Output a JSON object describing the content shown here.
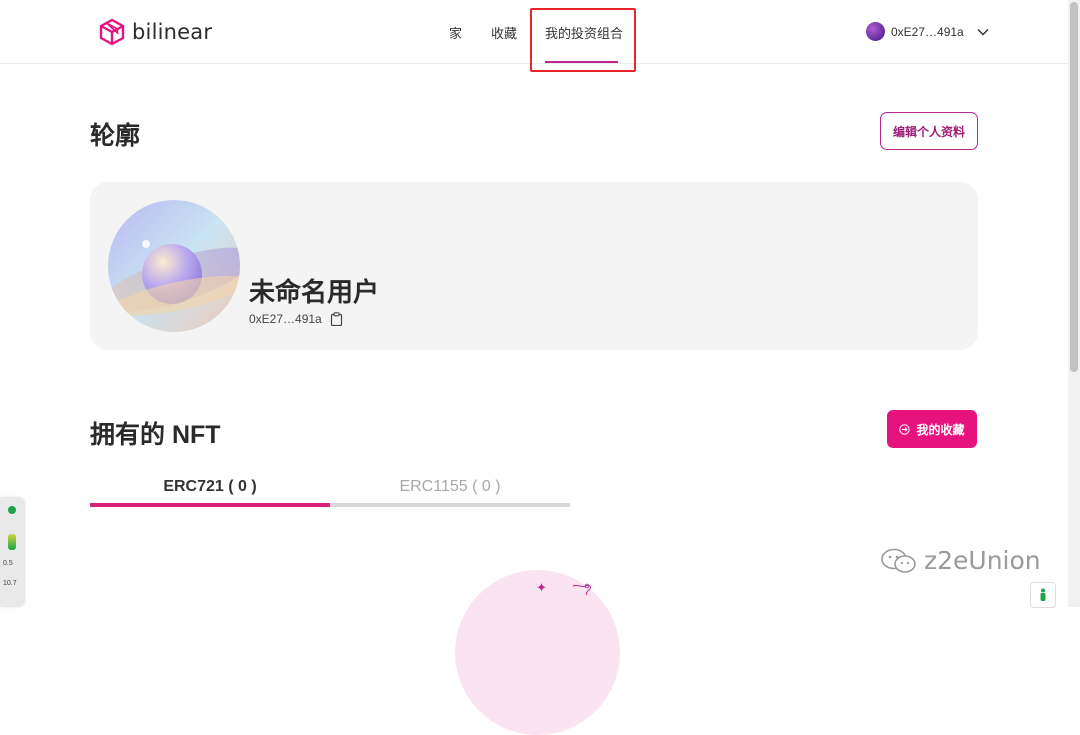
{
  "app": {
    "brand_name": "bilinear",
    "brand_color": "#e6137f"
  },
  "nav": {
    "home": "家",
    "favorites": "收藏",
    "portfolio": "我的投资组合"
  },
  "wallet": {
    "address": "0xE27…491a",
    "icon": "chevron-down-icon"
  },
  "profile": {
    "title": "轮廓",
    "edit_button": "编辑个人资料",
    "username": "未命名用户",
    "address": "0xE27…491a"
  },
  "owned": {
    "title": "拥有的 NFT",
    "collection_button": "我的收藏",
    "tabs": [
      {
        "label": "ERC721 ( 0 )",
        "active": true
      },
      {
        "label": "ERC1155 ( 0 )",
        "active": false
      }
    ]
  },
  "side_widget": {
    "value1": "0.5",
    "value2": "10.7"
  },
  "watermark": {
    "text": "z2eUnion"
  }
}
